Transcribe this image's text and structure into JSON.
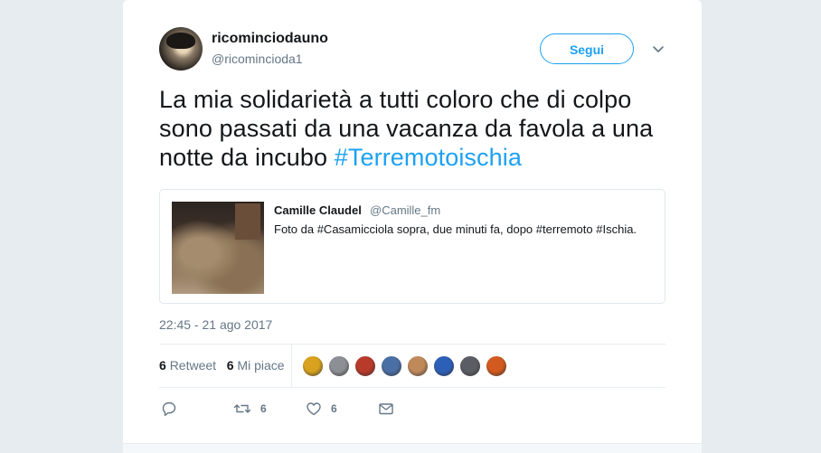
{
  "tweet": {
    "author_name": "ricominciodauno",
    "author_handle": "@ricomincioda1",
    "follow_label": "Segui",
    "text_main": "La mia solidarietà  a tutti coloro che di colpo sono passati da una vacanza da favola a una notte da incubo ",
    "text_hashtag": "#Terremotoischia",
    "timestamp": "22:45 - 21 ago 2017"
  },
  "quoted_tweet": {
    "author_name": "Camille Claudel",
    "author_handle": "@Camille_fm",
    "text": "Foto da #Casamicciola sopra, due minuti fa, dopo #terremoto #Ischia."
  },
  "stats": {
    "retweet_count": "6",
    "retweet_label": "Retweet",
    "like_count": "6",
    "like_label": "Mi piace"
  },
  "actions": {
    "reply_icon": "reply-icon",
    "retweet_count": "6",
    "like_count": "6",
    "dm_icon": "envelope-icon"
  },
  "likers_colors": [
    "#d8a21e",
    "#8c8f94",
    "#b83a2a",
    "#4a6fa5",
    "#c0895a",
    "#2c5fb8",
    "#5a5d63",
    "#d35a1e"
  ],
  "colors": {
    "accent": "#1da1f2",
    "text": "#14171a",
    "muted": "#657786",
    "border": "#e1e8ed"
  }
}
